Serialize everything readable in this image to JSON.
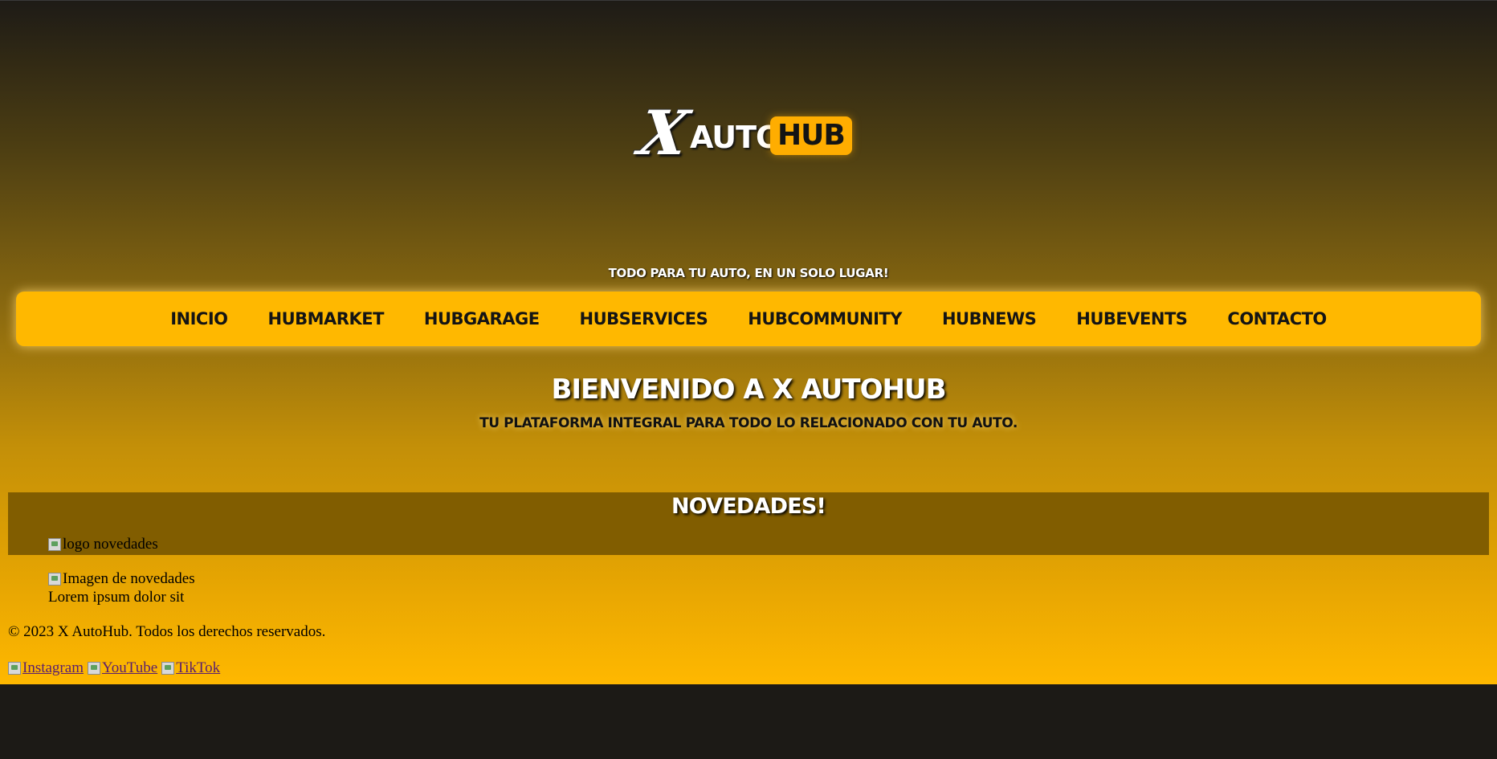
{
  "logo": {
    "x_letter": "X",
    "auto_word": "AUTO",
    "hub_word": "HUB"
  },
  "tagline": "TODO PARA TU AUTO, EN UN SOLO LUGAR!",
  "nav": [
    {
      "label": "INICIO"
    },
    {
      "label": "HUBMARKET"
    },
    {
      "label": "HUBGARAGE"
    },
    {
      "label": "HUBSERVICES"
    },
    {
      "label": "HUBCOMMUNITY"
    },
    {
      "label": "HUBNEWS"
    },
    {
      "label": "HUBEVENTS"
    },
    {
      "label": "CONTACTO"
    }
  ],
  "welcome": {
    "title": "BIENVENIDO A X AUTOHUB",
    "subtitle": "TU PLATAFORMA INTEGRAL PARA TODO LO RELACIONADO CON TU AUTO."
  },
  "news": {
    "title": "NOVEDADES!",
    "logo_alt": "logo novedades",
    "image_alt": "Imagen de novedades",
    "text": "Lorem ipsum dolor sit"
  },
  "footer": {
    "copyright": "© 2023 X AutoHub. Todos los derechos reservados.",
    "social": [
      {
        "label": "Instagram"
      },
      {
        "label": "YouTube"
      },
      {
        "label": "TikTok"
      }
    ]
  },
  "colors": {
    "accent": "#ffb800",
    "news_band": "#815d00",
    "page_bottom": "#1c1a16"
  }
}
